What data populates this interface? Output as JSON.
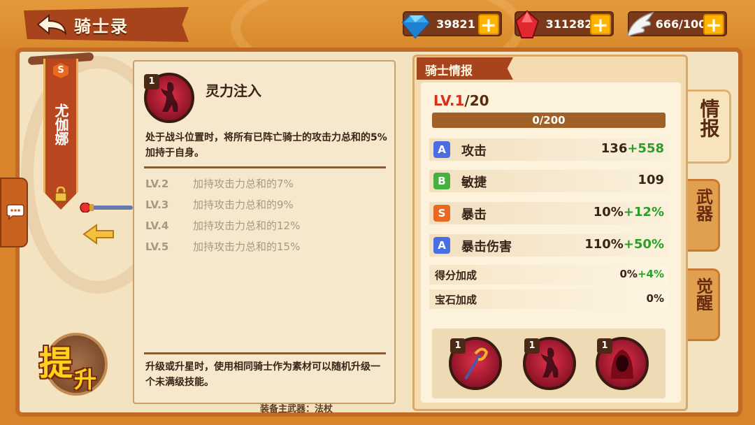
{
  "header": {
    "title": "骑士录",
    "currencies": [
      {
        "name": "diamond",
        "value": "39821",
        "icon": "diamond-icon"
      },
      {
        "name": "ruby",
        "value": "311282",
        "icon": "ruby-icon"
      },
      {
        "name": "wing",
        "value": "666/100",
        "icon": "wing-icon"
      }
    ],
    "plus_label": "+"
  },
  "hero": {
    "rank": "S",
    "name": "尤伽娜"
  },
  "upgrade": {
    "char1": "提",
    "char2": "升"
  },
  "skill": {
    "level": "1",
    "name": "灵力注入",
    "description": "处于战斗位置时，将所有已阵亡骑士的攻击力总和的5%加持于自身。",
    "levels": [
      {
        "lv": "LV.2",
        "text": "加持攻击力总和的7%"
      },
      {
        "lv": "LV.3",
        "text": "加持攻击力总和的9%"
      },
      {
        "lv": "LV.4",
        "text": "加持攻击力总和的12%"
      },
      {
        "lv": "LV.5",
        "text": "加持攻击力总和的15%"
      }
    ],
    "footer": "升级或升星时，使用相同骑士作为素材可以随机升级一个未满级技能。",
    "under_text": "装备主武器：法杖"
  },
  "info": {
    "header": "骑士情报",
    "level_current": "LV.1",
    "level_max": "/20",
    "exp_text": "0/200",
    "exp_fraction": 0,
    "stats": [
      {
        "grade": "A",
        "grade_color": "#4a6ee0",
        "name": "攻击",
        "base": "136",
        "bonus": "+558"
      },
      {
        "grade": "B",
        "grade_color": "#48b040",
        "name": "敏捷",
        "base": "109",
        "bonus": ""
      },
      {
        "grade": "S",
        "grade_color": "#e86a20",
        "name": "暴击",
        "base": "10%",
        "bonus": "+12%"
      },
      {
        "grade": "A",
        "grade_color": "#4a6ee0",
        "name": "暴击伤害",
        "base": "110%",
        "bonus": "+50%"
      }
    ],
    "extras": [
      {
        "name": "得分加成",
        "base": "0%",
        "bonus": "+4%"
      },
      {
        "name": "宝石加成",
        "base": "0%",
        "bonus": ""
      }
    ],
    "skill_levels": [
      "1",
      "1",
      "1"
    ]
  },
  "tabs": [
    {
      "label": "情报",
      "active": true
    },
    {
      "label": "武器",
      "active": false
    },
    {
      "label": "觉醒",
      "active": false
    }
  ]
}
